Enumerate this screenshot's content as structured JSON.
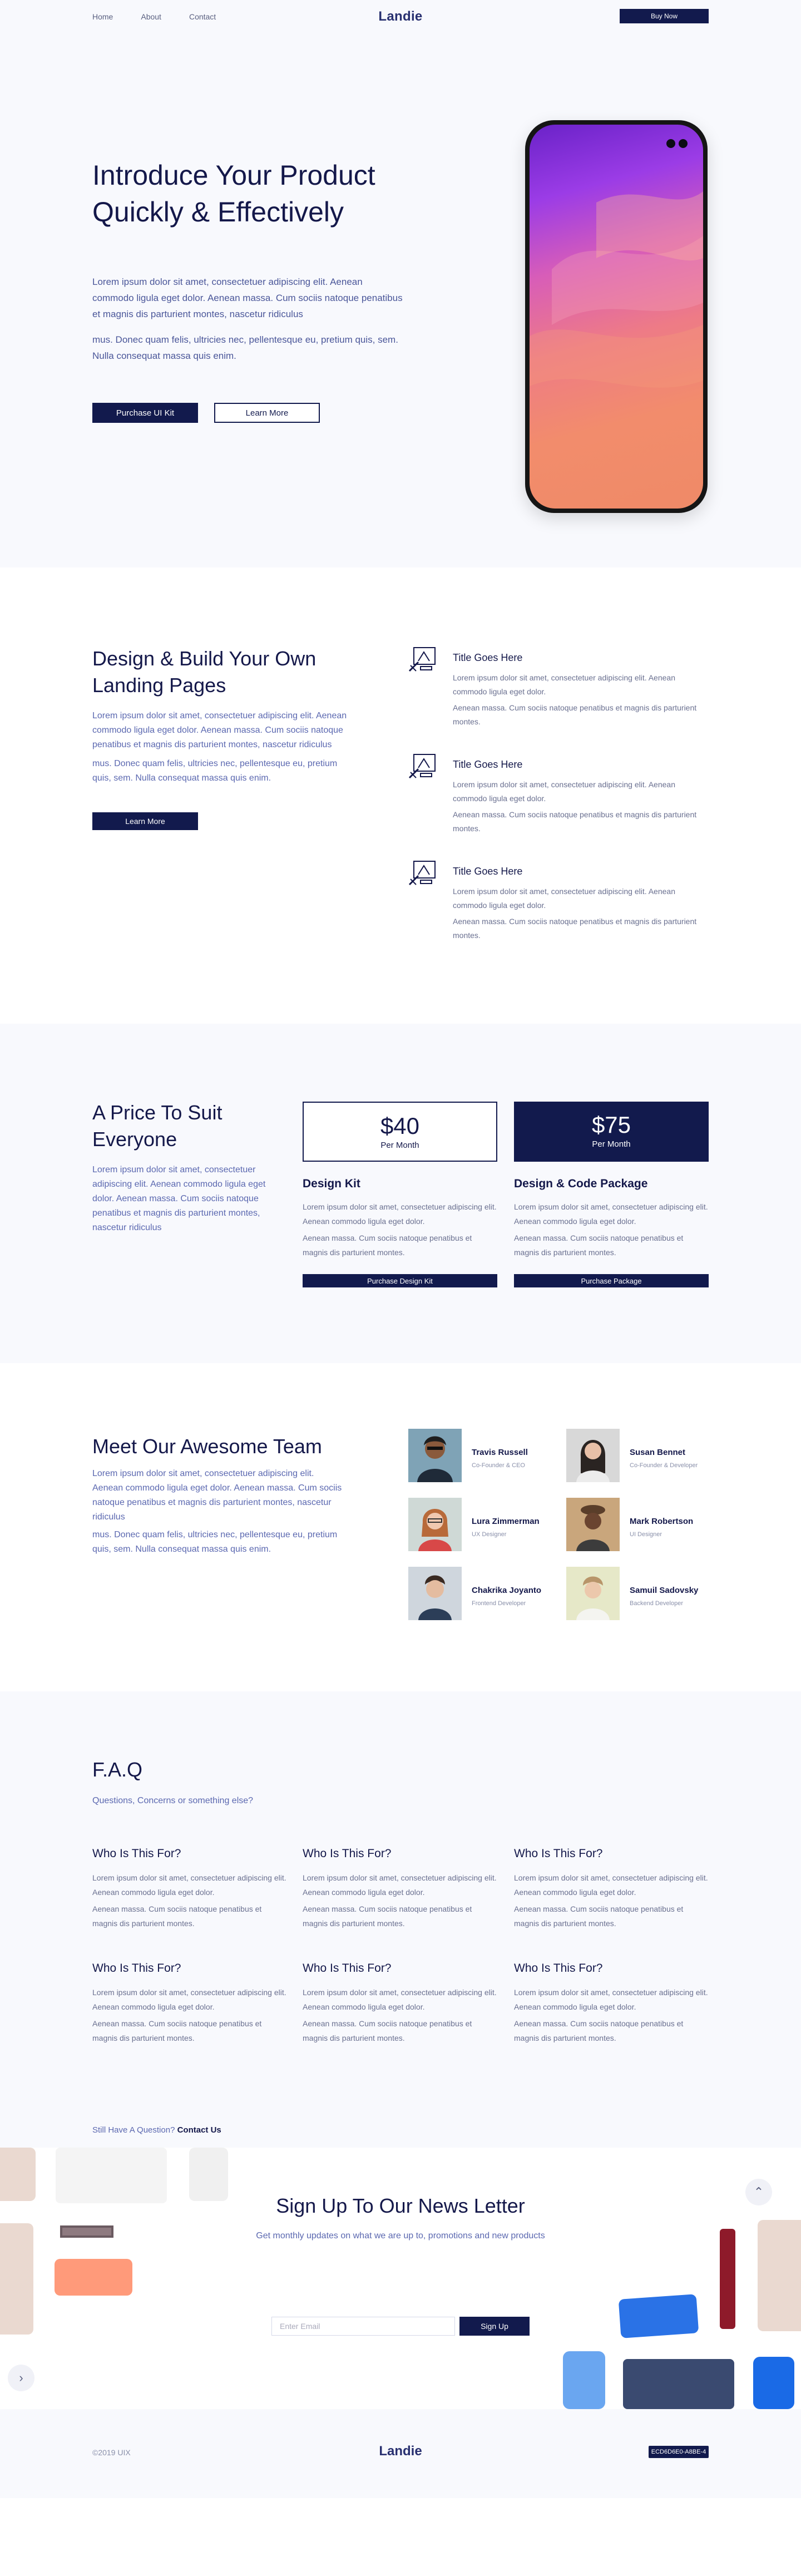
{
  "nav": {
    "links": [
      "Home",
      "About",
      "Contact"
    ],
    "brand": "Landie",
    "buy": "Buy Now"
  },
  "hero": {
    "title": "Introduce Your Product Quickly & Effectively",
    "p1": "Lorem ipsum dolor sit amet, consectetuer adipiscing elit. Aenean commodo ligula eget dolor. Aenean massa. Cum sociis natoque penatibus et magnis dis parturient montes, nascetur ridiculus",
    "p2": "mus. Donec quam felis, ultricies nec, pellentesque eu, pretium quis, sem. Nulla consequat massa quis enim.",
    "btn_primary": "Purchase UI Kit",
    "btn_secondary": "Learn More"
  },
  "design": {
    "title": "Design & Build Your Own Landing Pages",
    "p1": "Lorem ipsum dolor sit amet, consectetuer adipiscing elit. Aenean commodo ligula eget dolor. Aenean massa. Cum sociis natoque penatibus et magnis dis parturient montes, nascetur ridiculus",
    "p2": "mus. Donec quam felis, ultricies nec, pellentesque eu, pretium quis, sem. Nulla consequat massa quis enim.",
    "btn": "Learn More",
    "features": [
      {
        "title": "Title Goes Here",
        "p1": "Lorem ipsum dolor sit amet, consectetuer adipiscing elit. Aenean commodo ligula eget dolor.",
        "p2": "Aenean massa. Cum sociis natoque penatibus et magnis dis parturient montes.",
        "icon": "design-tool-icon"
      },
      {
        "title": "Title Goes Here",
        "p1": "Lorem ipsum dolor sit amet, consectetuer adipiscing elit. Aenean commodo ligula eget dolor.",
        "p2": "Aenean massa. Cum sociis natoque penatibus et magnis dis parturient montes.",
        "icon": "design-tool-icon"
      },
      {
        "title": "Title Goes Here",
        "p1": "Lorem ipsum dolor sit amet, consectetuer adipiscing elit. Aenean commodo ligula eget dolor.",
        "p2": "Aenean massa. Cum sociis natoque penatibus et magnis dis parturient montes.",
        "icon": "design-tool-icon"
      }
    ]
  },
  "pricing": {
    "title": "A Price To Suit Everyone",
    "desc": "Lorem ipsum dolor sit amet, consectetuer adipiscing elit. Aenean commodo ligula eget dolor. Aenean massa. Cum sociis natoque penatibus et magnis dis parturient montes, nascetur ridiculus",
    "plans": [
      {
        "price": "$40",
        "period": "Per Month",
        "name": "Design Kit",
        "p1": "Lorem ipsum dolor sit amet, consectetuer adipiscing elit. Aenean commodo ligula eget dolor.",
        "p2": "Aenean massa. Cum sociis natoque penatibus et magnis dis parturient montes.",
        "btn": "Purchase Design Kit"
      },
      {
        "price": "$75",
        "period": "Per Month",
        "name": "Design & Code Package",
        "p1": "Lorem ipsum dolor sit amet, consectetuer adipiscing elit. Aenean commodo ligula eget dolor.",
        "p2": "Aenean massa. Cum sociis natoque penatibus et magnis dis parturient montes.",
        "btn": "Purchase Package"
      }
    ]
  },
  "team": {
    "title": "Meet Our Awesome Team",
    "p1": "Lorem ipsum dolor sit amet, consectetuer adipiscing elit. Aenean commodo ligula eget dolor. Aenean massa. Cum sociis natoque penatibus et magnis dis parturient montes, nascetur ridiculus",
    "p2": "mus. Donec quam felis, ultricies nec, pellentesque eu, pretium quis, sem. Nulla consequat massa quis enim.",
    "members": [
      {
        "name": "Travis Russell",
        "role": "Co-Founder & CEO"
      },
      {
        "name": "Susan Bennet",
        "role": "Co-Founder & Developer"
      },
      {
        "name": "Lura Zimmerman",
        "role": "UX Designer"
      },
      {
        "name": "Mark Robertson",
        "role": "UI Designer"
      },
      {
        "name": "Chakrika Joyanto",
        "role": "Frontend Developer"
      },
      {
        "name": "Samuil Sadovsky",
        "role": "Backend Developer"
      }
    ]
  },
  "faq": {
    "title": "F.A.Q",
    "sub": "Questions, Concerns or something else?",
    "items": [
      {
        "q": "Who Is This For?",
        "a1": "Lorem ipsum dolor sit amet, consectetuer adipiscing elit. Aenean commodo ligula eget dolor.",
        "a2": "Aenean massa. Cum sociis natoque penatibus et magnis dis parturient montes."
      },
      {
        "q": "Who Is This For?",
        "a1": "Lorem ipsum dolor sit amet, consectetuer adipiscing elit. Aenean commodo ligula eget dolor.",
        "a2": "Aenean massa. Cum sociis natoque penatibus et magnis dis parturient montes."
      },
      {
        "q": "Who Is This For?",
        "a1": "Lorem ipsum dolor sit amet, consectetuer adipiscing elit. Aenean commodo ligula eget dolor.",
        "a2": "Aenean massa. Cum sociis natoque penatibus et magnis dis parturient montes."
      },
      {
        "q": "Who Is This For?",
        "a1": "Lorem ipsum dolor sit amet, consectetuer adipiscing elit. Aenean commodo ligula eget dolor.",
        "a2": "Aenean massa. Cum sociis natoque penatibus et magnis dis parturient montes."
      },
      {
        "q": "Who Is This For?",
        "a1": "Lorem ipsum dolor sit amet, consectetuer adipiscing elit. Aenean commodo ligula eget dolor.",
        "a2": "Aenean massa. Cum sociis natoque penatibus et magnis dis parturient montes."
      },
      {
        "q": "Who Is This For?",
        "a1": "Lorem ipsum dolor sit amet, consectetuer adipiscing elit. Aenean commodo ligula eget dolor.",
        "a2": "Aenean massa. Cum sociis natoque penatibus et magnis dis parturient montes."
      }
    ],
    "still": "Still Have A Question?",
    "contact": "Contact Us"
  },
  "news": {
    "title": "Sign Up To Our News Letter",
    "sub": "Get monthly updates on what we are up to, promotions and new products",
    "placeholder": "Enter Email",
    "btn": "Sign Up"
  },
  "footer": {
    "copy": "©2019 UIX",
    "brand": "Landie",
    "tag": "ECD6D6E0-A8BE-4"
  },
  "colors": {
    "primary": "#121a4d",
    "accent_text": "#5b68b0",
    "section_bg": "#f8f9fd"
  }
}
